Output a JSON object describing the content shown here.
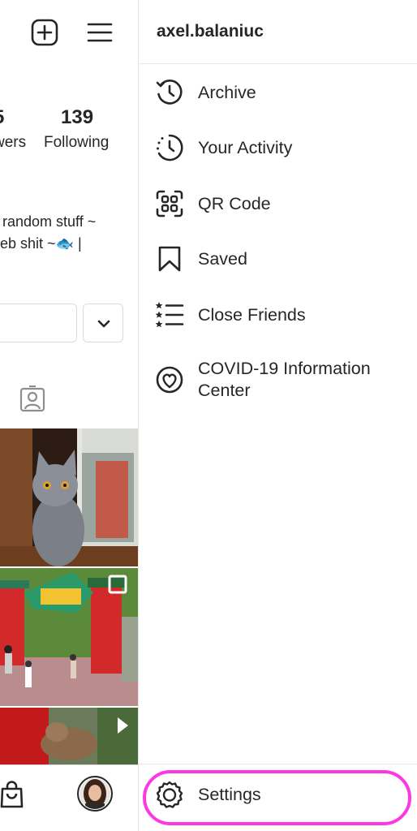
{
  "profile": {
    "followers_count_partial": "5",
    "followers_label_partial": "wers",
    "following_count": "139",
    "following_label": "Following",
    "bio_line1": "random stuff  ~",
    "bio_line2": "eb shit  ~🐟 |"
  },
  "drawer": {
    "username": "axel.balaniuc",
    "items": [
      {
        "label": "Archive",
        "icon": "archive-clock-icon"
      },
      {
        "label": "Your Activity",
        "icon": "activity-clock-icon"
      },
      {
        "label": "QR Code",
        "icon": "qr-code-icon"
      },
      {
        "label": "Saved",
        "icon": "bookmark-icon"
      },
      {
        "label": "Close Friends",
        "icon": "close-friends-list-icon"
      },
      {
        "label": "COVID-19 Information Center",
        "icon": "covid-heart-icon"
      }
    ],
    "settings": {
      "label": "Settings",
      "icon": "gear-icon"
    }
  },
  "colors": {
    "text": "#262626",
    "divider": "#dbdbdb",
    "highlight_ring": "#ff36e4"
  }
}
